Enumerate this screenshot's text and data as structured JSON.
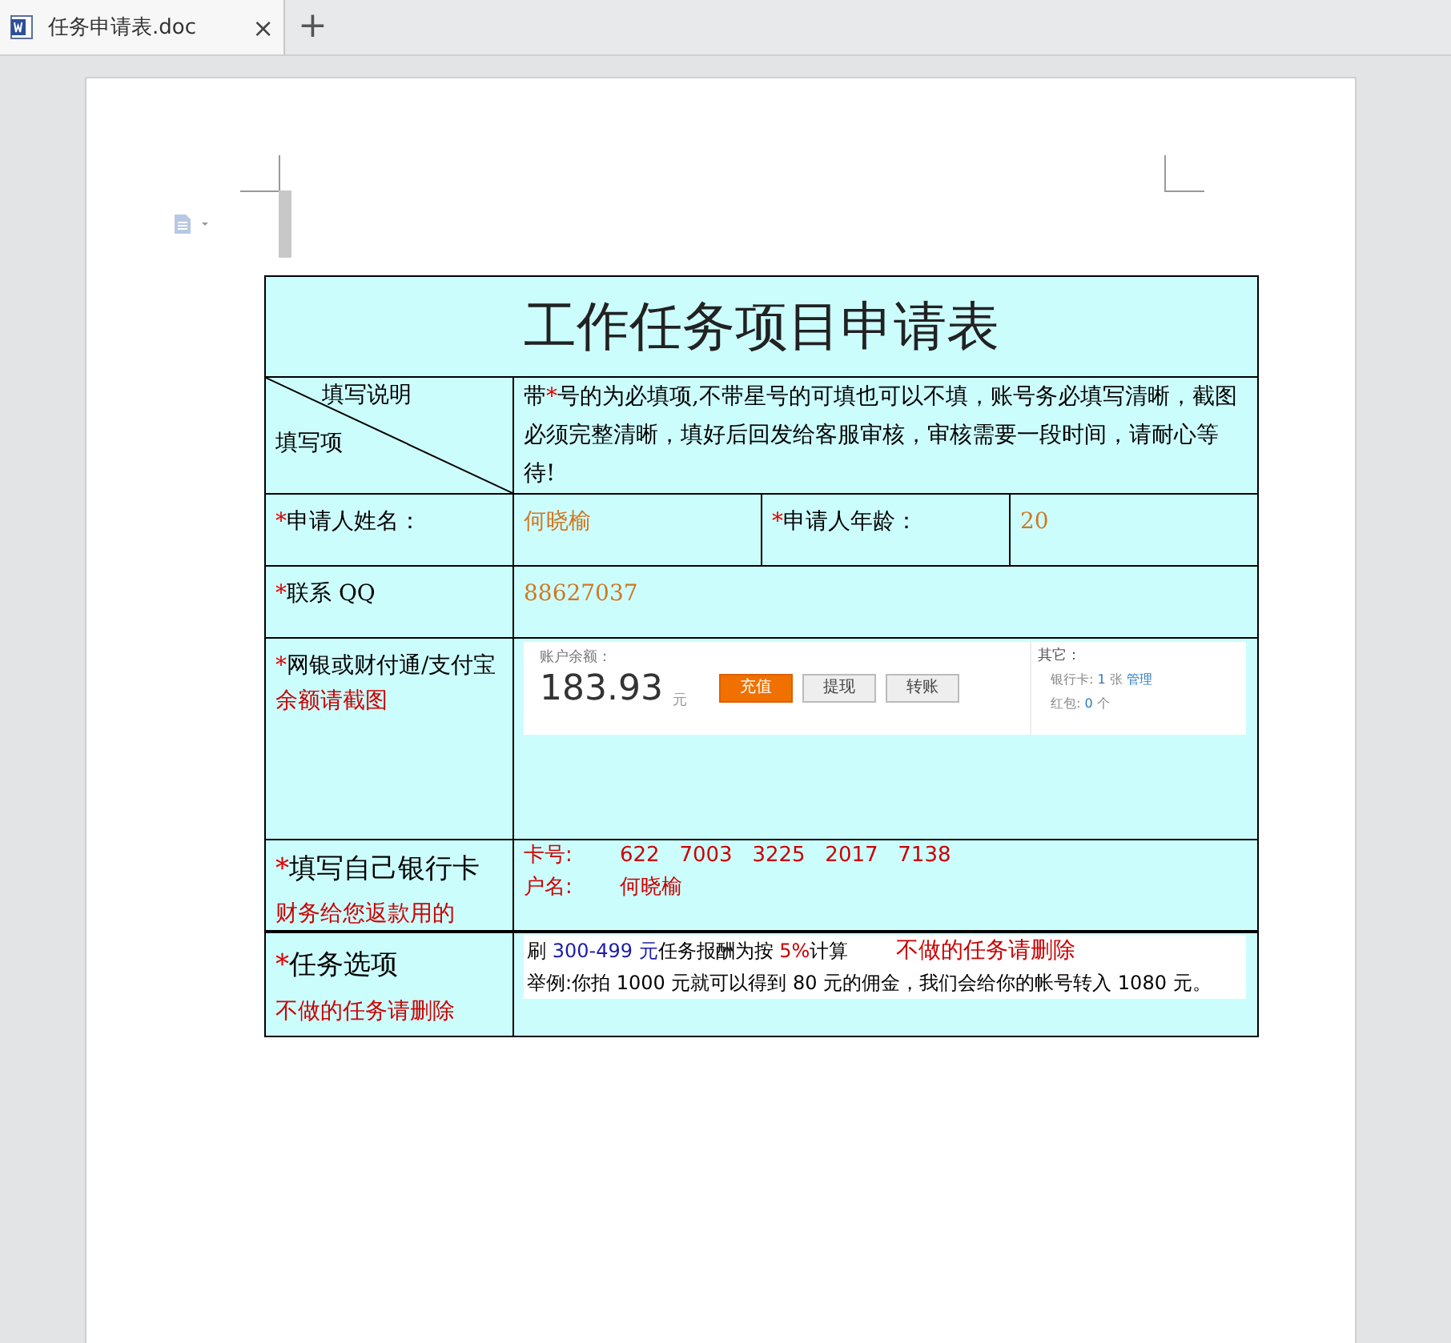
{
  "tabs": [
    {
      "label": "任务申请表.doc",
      "close": "×",
      "selected": true
    }
  ],
  "new_tab": "+",
  "document": {
    "title": "工作任务项目申请表",
    "corner": {
      "top": "填写说明",
      "bottom": "填写项"
    },
    "note": [
      {
        "text": "带"
      },
      {
        "text": "*",
        "color": "#e00000"
      },
      {
        "text": "号的为必填项,不带星号的可填也可以不填，账号务必填写清晰，截图必须完整清晰，填好后回发给客服审核，审核需要一段时间，请耐心等待!"
      }
    ],
    "rows": [
      {
        "kind": "fields",
        "cells": [
          {
            "segments": [
              {
                "text": "*",
                "color": "#e00000"
              },
              {
                "text": "申请人姓名："
              }
            ]
          },
          {
            "segments": [
              {
                "text": "何晓榆",
                "color": "#d07820"
              }
            ]
          },
          {
            "segments": [
              {
                "text": "*",
                "color": "#e00000"
              },
              {
                "text": "申请人年龄："
              }
            ]
          },
          {
            "segments": [
              {
                "text": "20",
                "color": "#d07820"
              }
            ]
          }
        ]
      },
      {
        "kind": "fields",
        "cells": [
          {
            "segments": [
              {
                "text": "*",
                "color": "#e00000"
              },
              {
                "text": "联系 QQ"
              }
            ]
          },
          {
            "segments": [
              {
                "text": "88627037",
                "color": "#d07820"
              }
            ]
          }
        ]
      },
      {
        "kind": "screenshot",
        "label": [
          {
            "text": "*",
            "color": "#e00000"
          },
          {
            "text": "网银或财付通/支付宝"
          },
          {
            "text": "余额请截图",
            "color": "#cc0000"
          }
        ],
        "shot": {
          "balance_label": "账户余额：",
          "amount": "183.93",
          "unit": "元",
          "buttons": [
            {
              "label": "充值",
              "primary": true
            },
            {
              "label": "提现",
              "primary": false
            },
            {
              "label": "转账",
              "primary": false
            }
          ],
          "side_title": "其它：",
          "side_items": [
            [
              {
                "text": "银行卡: "
              },
              {
                "text": "1",
                "color": "#2a7ac0"
              },
              {
                "text": " 张 "
              },
              {
                "text": "管理",
                "color": "#2a7ac0"
              }
            ],
            [
              {
                "text": "红包: "
              },
              {
                "text": "0",
                "color": "#2a7ac0"
              },
              {
                "text": " 个"
              }
            ]
          ]
        }
      },
      {
        "kind": "lines",
        "label": [
          [
            {
              "text": "*",
              "color": "#e00000"
            },
            {
              "text": "填写自己银行卡"
            }
          ],
          [
            {
              "text": "财务给您返款用的",
              "color": "#cc0000"
            }
          ]
        ],
        "lines": [
          [
            {
              "text": "卡号:",
              "color": "#cc0000"
            },
            {
              "text": "622   7003   3225   2017   7138",
              "color": "#cc0000"
            }
          ],
          [
            {
              "text": "户名:",
              "color": "#cc0000"
            },
            {
              "text": "何晓榆",
              "color": "#cc0000"
            }
          ]
        ]
      },
      {
        "kind": "task",
        "label": [
          [
            {
              "text": "*",
              "color": "#e00000"
            },
            {
              "text": "任务选项"
            }
          ],
          [
            {
              "text": "不做的任务请删除",
              "color": "#cc0000"
            }
          ]
        ],
        "lines": [
          [
            {
              "text": "刷 "
            },
            {
              "text": "300-499 元",
              "color": "#1a1aaa"
            },
            {
              "text": "任务报酬为按 "
            },
            {
              "text": "5%",
              "color": "#cc0000"
            },
            {
              "text": "计算"
            }
          ],
          [
            {
              "text": "举例:你拍 1000 元就可以得到 80 元的佣金，我们会给你的帐号转入 1080 元。"
            }
          ]
        ],
        "side_note": {
          "text": "不做的任务请删除",
          "color": "#cc0000"
        }
      }
    ]
  }
}
